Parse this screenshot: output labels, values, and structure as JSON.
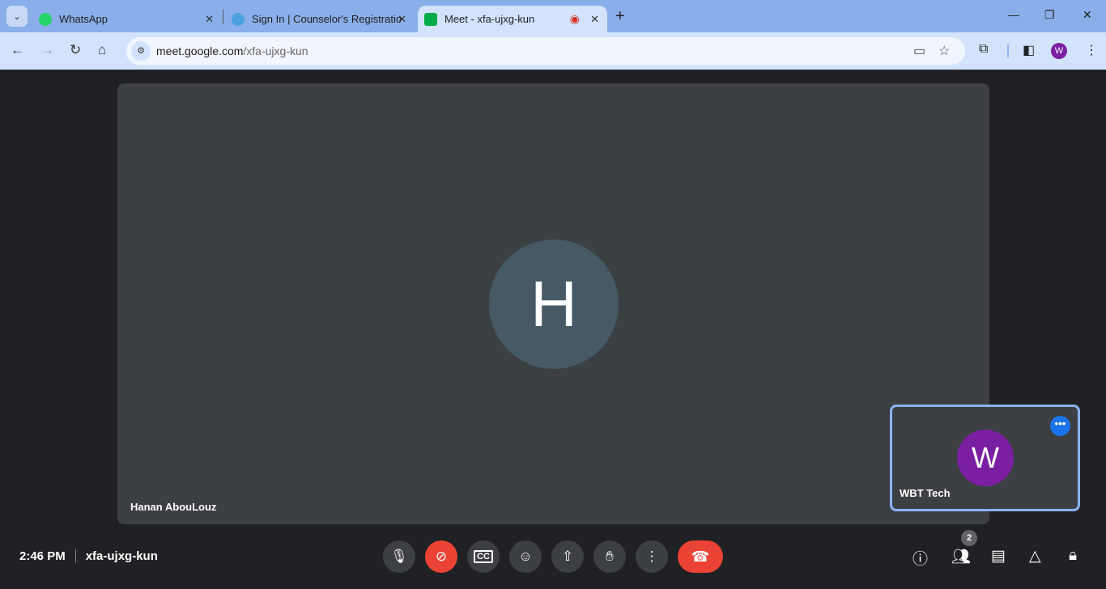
{
  "browser": {
    "tabs": [
      {
        "label": "WhatsApp",
        "color": "#25d366"
      },
      {
        "label": "Sign In | Counselor's Registratio",
        "color": "#4aa3df"
      },
      {
        "label": "Meet - xfa-ujxg-kun",
        "color": "#00ac47"
      }
    ],
    "url_host": "meet.google.com",
    "url_path": "/xfa-ujxg-kun",
    "profile_initial": "W"
  },
  "meeting": {
    "main_participant": {
      "initial": "H",
      "name": "Hanan AbouLouz"
    },
    "self": {
      "initial": "W",
      "name": "WBT Tech"
    },
    "time": "2:46 PM",
    "code": "xfa-ujxg-kun",
    "participant_count": "2"
  }
}
